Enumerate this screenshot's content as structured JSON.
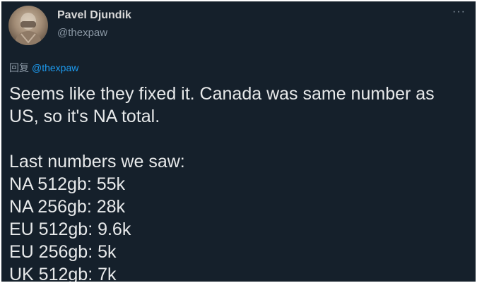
{
  "author": {
    "display_name": "Pavel Djundik",
    "handle": "@thexpaw",
    "avatar_icon": "user-avatar"
  },
  "menu": {
    "more_icon": "···"
  },
  "reply": {
    "prefix": "回复",
    "mention": "@thexpaw"
  },
  "tweet": {
    "paragraph1": [
      "Seems like they fixed it. Canada was same number as",
      "US, so it's NA total."
    ],
    "paragraph2": [
      "Last numbers we saw:",
      "NA 512gb: 55k",
      "NA 256gb: 28k",
      "EU 512gb: 9.6k",
      "EU 256gb: 5k",
      "UK 512gb: 7k"
    ]
  },
  "colors": {
    "background": "#15202b",
    "text": "#e7e9ea",
    "muted": "#8b98a5",
    "link": "#1d9bf0"
  }
}
